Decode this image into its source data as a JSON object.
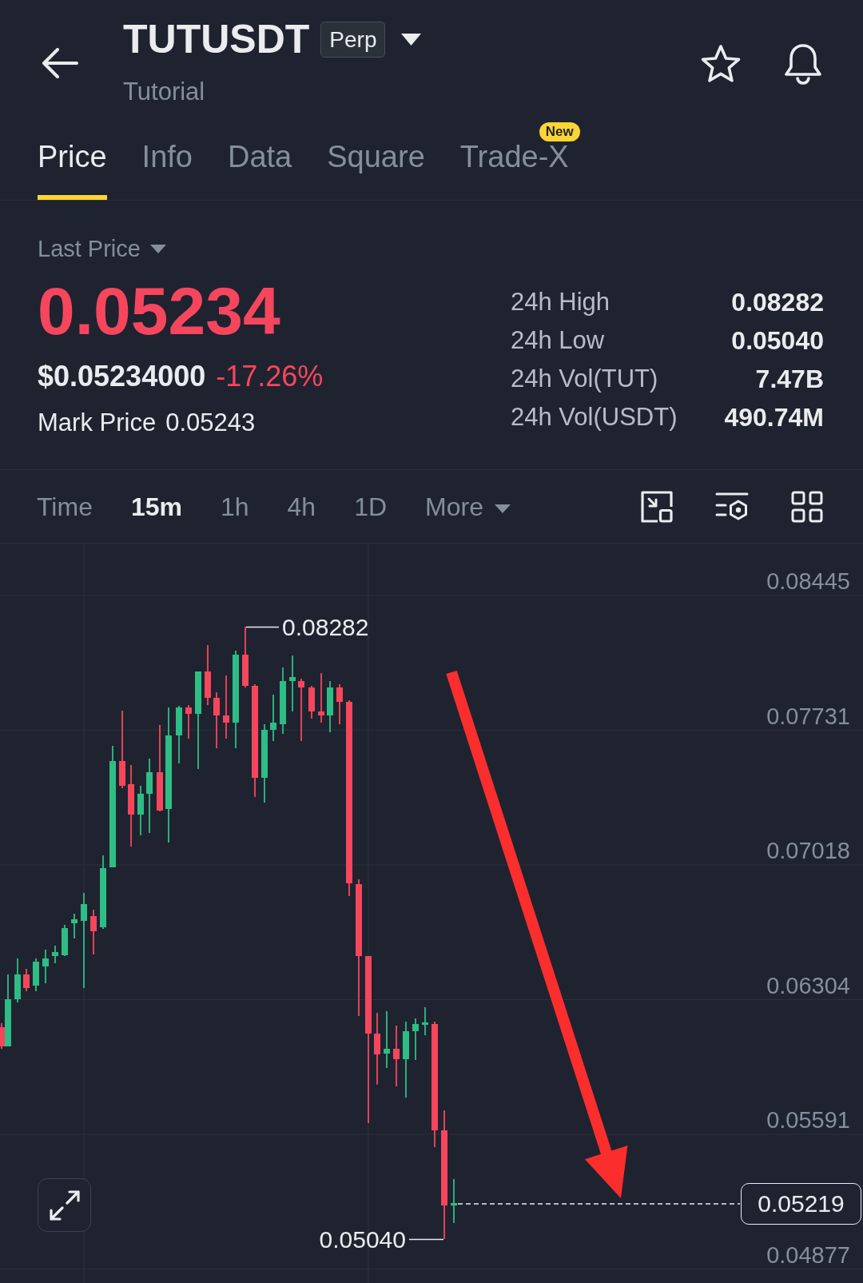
{
  "header": {
    "symbol": "TUTUSDT",
    "contract_type": "Perp",
    "subtitle": "Tutorial"
  },
  "tabs": [
    {
      "label": "Price",
      "selected": true
    },
    {
      "label": "Info",
      "selected": false
    },
    {
      "label": "Data",
      "selected": false
    },
    {
      "label": "Square",
      "selected": false
    },
    {
      "label": "Trade-X",
      "selected": false,
      "badge": "New"
    }
  ],
  "price_panel": {
    "selector_label": "Last Price",
    "last_price": "0.05234",
    "usd_price": "$0.05234000",
    "change": "-17.26%",
    "mark_price_label": "Mark Price",
    "mark_price": "0.05243",
    "stats": [
      {
        "label": "24h High",
        "value": "0.08282"
      },
      {
        "label": "24h Low",
        "value": "0.05040"
      },
      {
        "label": "24h Vol(TUT)",
        "value": "7.47B"
      },
      {
        "label": "24h Vol(USDT)",
        "value": "490.74M"
      }
    ]
  },
  "intervals": [
    {
      "label": "Time",
      "kind": "interval",
      "selected": false
    },
    {
      "label": "15m",
      "kind": "interval",
      "selected": true
    },
    {
      "label": "1h",
      "kind": "interval",
      "selected": false
    },
    {
      "label": "4h",
      "kind": "interval",
      "selected": false
    },
    {
      "label": "1D",
      "kind": "interval",
      "selected": false
    },
    {
      "label": "More",
      "kind": "dropdown",
      "selected": false
    }
  ],
  "chart": {
    "y_axis_labels": [
      "0.08445",
      "0.07731",
      "0.07018",
      "0.06304",
      "0.05591",
      "0.04877"
    ],
    "high_label": "0.08282",
    "low_label": "0.05040",
    "current_price_label": "0.05219"
  }
}
